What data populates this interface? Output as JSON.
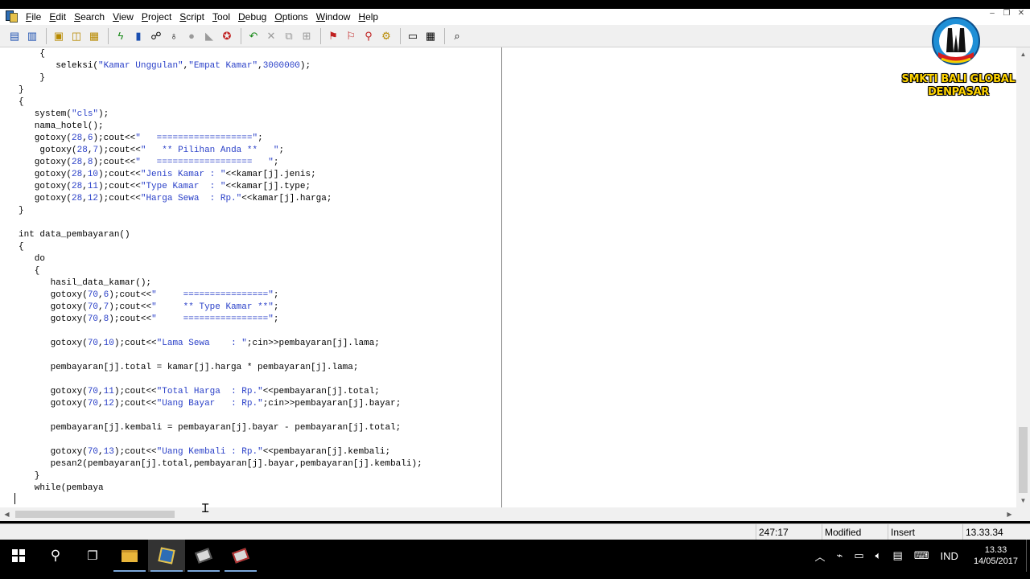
{
  "menu": [
    "File",
    "Edit",
    "Search",
    "View",
    "Project",
    "Script",
    "Tool",
    "Debug",
    "Options",
    "Window",
    "Help"
  ],
  "menu_underline": [
    "F",
    "E",
    "S",
    "V",
    "P",
    "S",
    "T",
    "D",
    "O",
    "W",
    "H"
  ],
  "toolbar_icons": [
    "new-file",
    "open-file",
    "save",
    "save-all",
    "print",
    "compile",
    "run",
    "compile-run",
    "rebuild",
    "debug",
    "stop",
    "undo",
    "cut",
    "copy",
    "paste",
    "find",
    "replace",
    "goto",
    "class-browser",
    "project-options",
    "help"
  ],
  "code_lines": [
    "    {",
    "       seleksi(\"Kamar Unggulan\",\"Empat Kamar\",3000000);",
    "    }",
    "}",
    "{",
    "   system(\"cls\");",
    "   nama_hotel();",
    "   gotoxy(28,6);cout<<\"   ==================\";",
    "    gotoxy(28,7);cout<<\"   ** Pilihan Anda **   \";",
    "   gotoxy(28,8);cout<<\"   ==================   \";",
    "   gotoxy(28,10);cout<<\"Jenis Kamar : \"<<kamar[j].jenis;",
    "   gotoxy(28,11);cout<<\"Type Kamar  : \"<<kamar[j].type;",
    "   gotoxy(28,12);cout<<\"Harga Sewa  : Rp.\"<<kamar[j].harga;",
    "}",
    "",
    "int data_pembayaran()",
    "{",
    "   do",
    "   {",
    "      hasil_data_kamar();",
    "      gotoxy(70,6);cout<<\"     ================\";",
    "      gotoxy(70,7);cout<<\"     ** Type Kamar **\";",
    "      gotoxy(70,8);cout<<\"     ================\";",
    "",
    "      gotoxy(70,10);cout<<\"Lama Sewa    : \";cin>>pembayaran[j].lama;",
    "",
    "      pembayaran[j].total = kamar[j].harga * pembayaran[j].lama;",
    "",
    "      gotoxy(70,11);cout<<\"Total Harga  : Rp.\"<<pembayaran[j].total;",
    "      gotoxy(70,12);cout<<\"Uang Bayar   : Rp.\";cin>>pembayaran[j].bayar;",
    "",
    "      pembayaran[j].kembali = pembayaran[j].bayar - pembayaran[j].total;",
    "",
    "      gotoxy(70,13);cout<<\"Uang Kembali : Rp.\"<<pembayaran[j].kembali;",
    "      pesan2(pembayaran[j].total,pembayaran[j].bayar,pembayaran[j].kembali);",
    "   }",
    "   while(pembaya"
  ],
  "syntax_colors": {
    "string": "#2a40c8",
    "number": "#2a40c8",
    "text": "#000000"
  },
  "status": {
    "position": "247:17",
    "modified": "Modified",
    "mode": "Insert",
    "time": "13.33.34"
  },
  "taskbar": {
    "apps": [
      "start",
      "search",
      "task-view",
      "file-explorer",
      "devcpp",
      "app-2",
      "app-3"
    ],
    "tray_lang": "IND",
    "clock_time": "13.33",
    "clock_date": "14/05/2017"
  },
  "watermark": {
    "line1": "SMKTI BALI GLOBAL",
    "line2": "DENPASAR"
  }
}
